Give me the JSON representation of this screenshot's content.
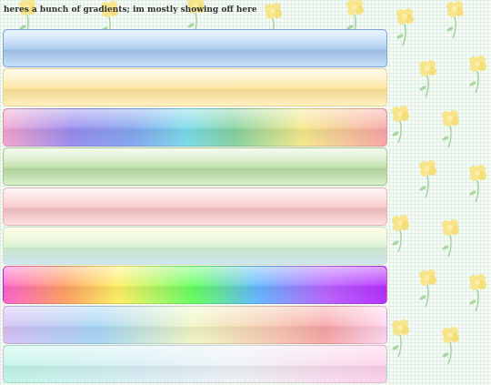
{
  "header": {
    "text": "heres a bunch of gradients; im mostly showing off here"
  },
  "gradient_bars": [
    {
      "name": "blue glossy"
    },
    {
      "name": "yellow glossy"
    },
    {
      "name": "pastel rainbow"
    },
    {
      "name": "green glossy"
    },
    {
      "name": "pink glossy"
    },
    {
      "name": "yellow to blue"
    },
    {
      "name": "bright rainbow"
    },
    {
      "name": "pastel lavender rainbow"
    },
    {
      "name": "mint to pink"
    }
  ],
  "background": {
    "pattern": "yellow flowers on mint grid",
    "colors": [
      "#f7fbf4",
      "#f9e07a",
      "#9fcf9a"
    ]
  }
}
